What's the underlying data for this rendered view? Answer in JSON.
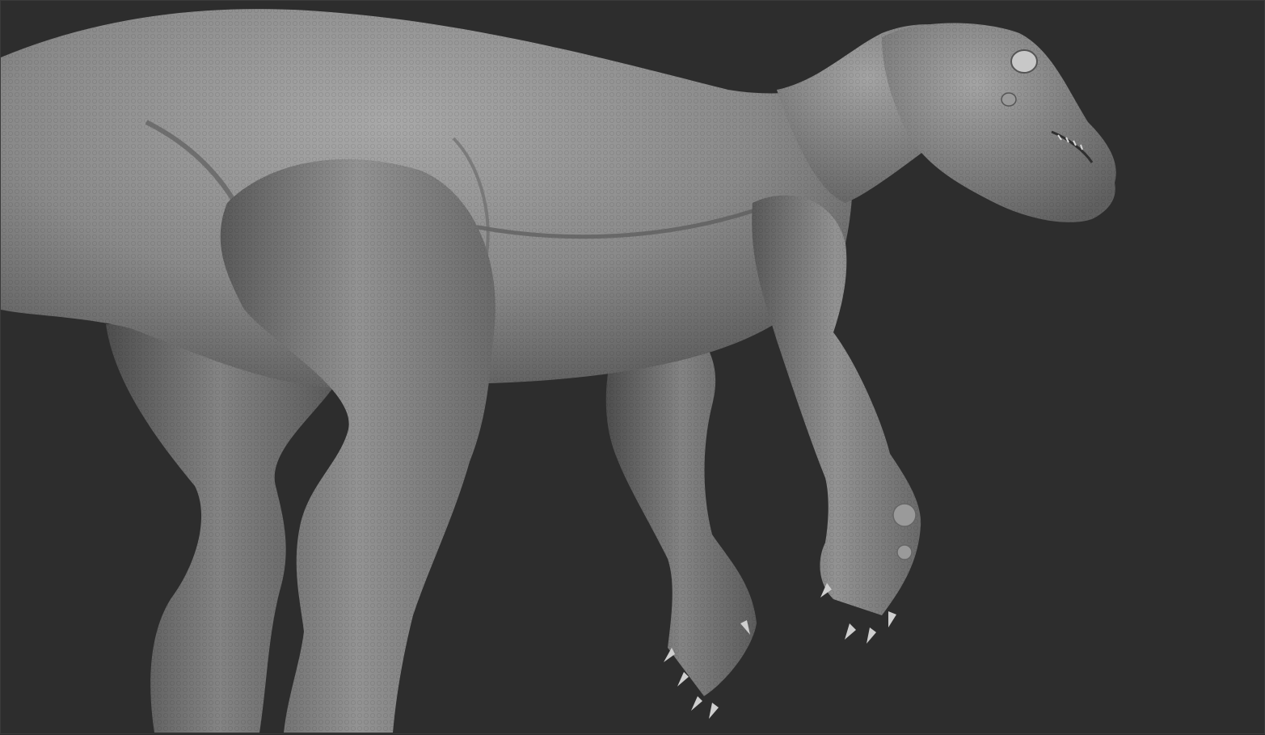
{
  "viewport": {
    "background_color": "#2d2d2d",
    "frame_color": "#3a3a3a"
  },
  "model": {
    "subject": "dinosaur-sculpt",
    "material_color": "#8a8a8a",
    "highlight_color": "#b4b4b4",
    "shadow_color": "#4a4a4a"
  }
}
